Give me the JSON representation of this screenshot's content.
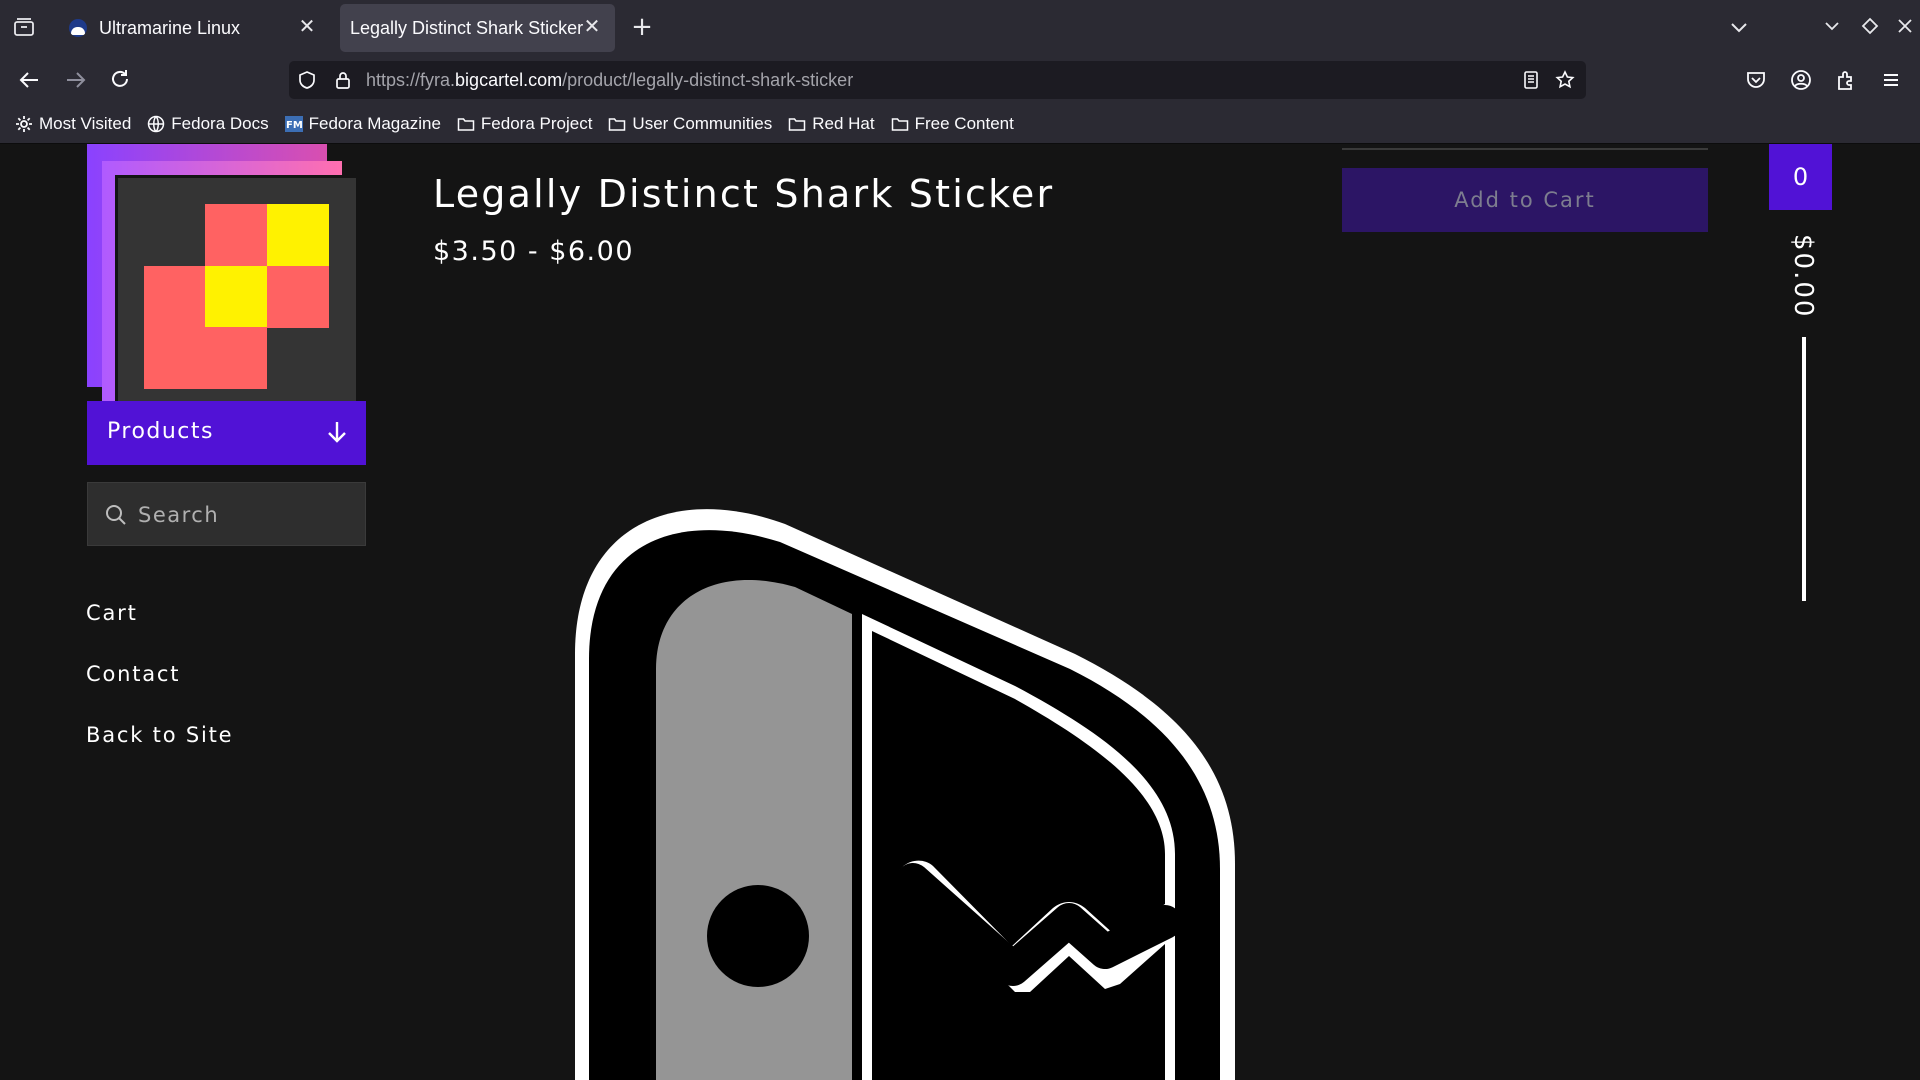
{
  "browser": {
    "tabs": [
      {
        "title": "Ultramarine Linux",
        "active": false
      },
      {
        "title": "Legally Distinct Shark Sticker",
        "active": true
      }
    ],
    "url": {
      "prefix": "https://fyra.",
      "host": "bigcartel.com",
      "path": "/product/legally-distinct-shark-sticker"
    },
    "bookmarks": [
      {
        "label": "Most Visited",
        "icon": "gear-icon"
      },
      {
        "label": "Fedora Docs",
        "icon": "globe-icon"
      },
      {
        "label": "Fedora Magazine",
        "icon": "fm-icon"
      },
      {
        "label": "Fedora Project",
        "icon": "folder-icon"
      },
      {
        "label": "User Communities",
        "icon": "folder-icon"
      },
      {
        "label": "Red Hat",
        "icon": "folder-icon"
      },
      {
        "label": "Free Content",
        "icon": "folder-icon"
      }
    ]
  },
  "store": {
    "nav": {
      "products_label": "Products",
      "search_placeholder": "Search",
      "links": [
        "Cart",
        "Contact",
        "Back to Site"
      ]
    },
    "product": {
      "title": "Legally Distinct Shark Sticker",
      "price": "$3.50 - $6.00",
      "add_to_cart": "Add to Cart"
    },
    "cart": {
      "count": "0",
      "total": "$0.00"
    }
  },
  "colors": {
    "accent": "#5112d6",
    "button_disabled": "#2c1565",
    "logo_red": "#ff6262",
    "logo_yellow": "#fff200",
    "background": "#141414"
  }
}
